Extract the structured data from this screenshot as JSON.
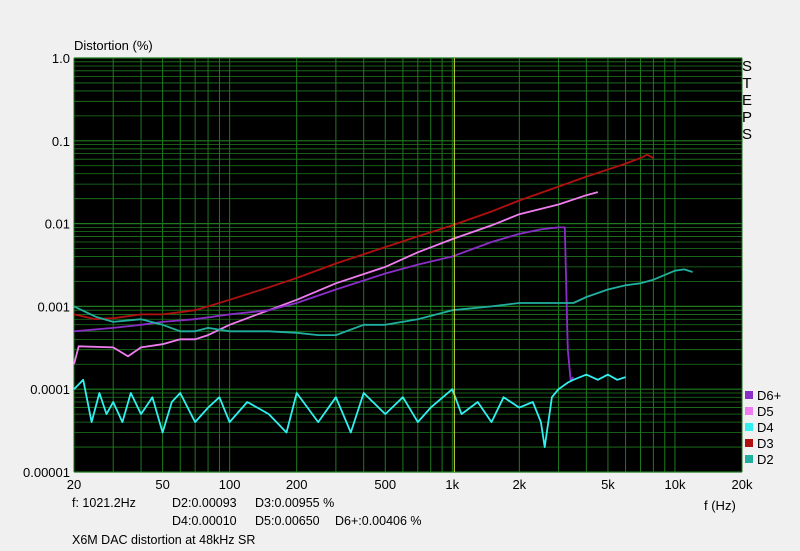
{
  "chart_data": {
    "type": "line",
    "title": "",
    "ylabel": "Distortion (%)",
    "xlabel": "f (Hz)",
    "x_scale": "log",
    "y_scale": "log",
    "xlim": [
      20,
      20000
    ],
    "ylim": [
      1e-05,
      1.0
    ],
    "grid": true,
    "background": "#000000",
    "grid_color": "#1f7a1f",
    "x_ticks": [
      {
        "value": 20,
        "label": "20"
      },
      {
        "value": 50,
        "label": "50"
      },
      {
        "value": 100,
        "label": "100"
      },
      {
        "value": 200,
        "label": "200"
      },
      {
        "value": 500,
        "label": "500"
      },
      {
        "value": 1000,
        "label": "1k"
      },
      {
        "value": 2000,
        "label": "2k"
      },
      {
        "value": 5000,
        "label": "5k"
      },
      {
        "value": 10000,
        "label": "10k"
      },
      {
        "value": 20000,
        "label": "20k"
      }
    ],
    "y_ticks": [
      {
        "value": 1.0,
        "label": "1.0"
      },
      {
        "value": 0.1,
        "label": "0.1"
      },
      {
        "value": 0.01,
        "label": "0.01"
      },
      {
        "value": 0.001,
        "label": "0.001"
      },
      {
        "value": 0.0001,
        "label": "0.0001"
      },
      {
        "value": 1e-05,
        "label": "0.00001"
      }
    ],
    "cursor_x": 1021.2,
    "cursor_color": "#e0e040",
    "legend_position": "bottom-right",
    "series": [
      {
        "name": "D3",
        "color": "#b01010",
        "x": [
          20,
          25,
          30,
          40,
          50,
          60,
          70,
          80,
          100,
          150,
          200,
          300,
          500,
          700,
          1000,
          1500,
          2000,
          3000,
          4000,
          5000,
          6000,
          7000,
          7500,
          8000
        ],
        "y": [
          0.0008,
          0.0007,
          0.00072,
          0.0008,
          0.0008,
          0.00085,
          0.0009,
          0.001,
          0.0012,
          0.0017,
          0.0022,
          0.0033,
          0.0052,
          0.007,
          0.0095,
          0.014,
          0.019,
          0.028,
          0.037,
          0.045,
          0.053,
          0.062,
          0.068,
          0.062
        ]
      },
      {
        "name": "D5",
        "color": "#f07df0",
        "x": [
          20,
          21,
          30,
          35,
          40,
          50,
          60,
          70,
          80,
          100,
          150,
          200,
          300,
          500,
          700,
          1000,
          1500,
          2000,
          3000,
          4000,
          4500
        ],
        "y": [
          0.0002,
          0.00033,
          0.00032,
          0.00025,
          0.00032,
          0.00035,
          0.0004,
          0.0004,
          0.00045,
          0.0006,
          0.0009,
          0.0012,
          0.0019,
          0.003,
          0.0045,
          0.0065,
          0.0095,
          0.013,
          0.017,
          0.022,
          0.024
        ]
      },
      {
        "name": "D6+",
        "color": "#8a2ec8",
        "x": [
          20,
          30,
          40,
          50,
          70,
          100,
          150,
          200,
          300,
          500,
          700,
          1000,
          1500,
          2000,
          2500,
          3000,
          3200,
          3300,
          3400,
          3500
        ],
        "y": [
          0.0005,
          0.00055,
          0.0006,
          0.00065,
          0.0007,
          0.0008,
          0.0009,
          0.0011,
          0.0016,
          0.0025,
          0.0032,
          0.004,
          0.006,
          0.0075,
          0.0085,
          0.009,
          0.009,
          0.0003,
          0.00013,
          0.00014
        ]
      },
      {
        "name": "D2",
        "color": "#20b0a0",
        "x": [
          20,
          25,
          30,
          40,
          50,
          60,
          70,
          80,
          100,
          150,
          200,
          250,
          300,
          400,
          500,
          700,
          1000,
          1500,
          2000,
          3000,
          3500,
          4000,
          5000,
          6000,
          7000,
          8000,
          10000,
          11000,
          12000
        ],
        "y": [
          0.001,
          0.00075,
          0.00065,
          0.0007,
          0.0006,
          0.0005,
          0.0005,
          0.00055,
          0.0005,
          0.0005,
          0.00048,
          0.00045,
          0.00045,
          0.0006,
          0.0006,
          0.0007,
          0.0009,
          0.001,
          0.0011,
          0.0011,
          0.0011,
          0.0013,
          0.0016,
          0.0018,
          0.0019,
          0.0021,
          0.0027,
          0.0028,
          0.0026
        ]
      },
      {
        "name": "D4",
        "color": "#30f0f0",
        "x": [
          20,
          22,
          24,
          26,
          28,
          30,
          33,
          36,
          40,
          45,
          50,
          55,
          60,
          70,
          80,
          90,
          100,
          120,
          150,
          180,
          200,
          250,
          300,
          350,
          400,
          500,
          600,
          700,
          800,
          1000,
          1100,
          1300,
          1500,
          1700,
          2000,
          2300,
          2500,
          2600,
          2800,
          3000,
          3300,
          3500,
          4000,
          4500,
          5000,
          5500,
          6000
        ],
        "y": [
          0.0001,
          0.00013,
          4e-05,
          9e-05,
          5e-05,
          7e-05,
          4e-05,
          9e-05,
          5e-05,
          8e-05,
          3e-05,
          7e-05,
          9e-05,
          4e-05,
          6e-05,
          8e-05,
          4e-05,
          7e-05,
          5e-05,
          3e-05,
          9e-05,
          4e-05,
          8e-05,
          3e-05,
          9e-05,
          5e-05,
          8e-05,
          4e-05,
          6e-05,
          0.0001,
          5e-05,
          7e-05,
          4e-05,
          8e-05,
          6e-05,
          7e-05,
          4e-05,
          2e-05,
          8e-05,
          0.0001,
          0.00012,
          0.00013,
          0.00015,
          0.00013,
          0.00015,
          0.00013,
          0.00014
        ]
      }
    ]
  },
  "readouts": {
    "freq": "f: 1021.2Hz",
    "d2": "D2:0.00093",
    "d3": "D3:0.00955 %",
    "d4": "D4:0.00010",
    "d5": "D5:0.00650",
    "d6": "D6+:0.00406 %",
    "caption": "X6M DAC distortion at 48kHz SR"
  },
  "side_label": [
    "S",
    "T",
    "E",
    "P",
    "S"
  ],
  "legend": [
    {
      "label": "D6+",
      "color": "#8a2ec8"
    },
    {
      "label": "D5",
      "color": "#f07df0"
    },
    {
      "label": "D4",
      "color": "#30f0f0"
    },
    {
      "label": "D3",
      "color": "#b01010"
    },
    {
      "label": "D2",
      "color": "#20b0a0"
    }
  ]
}
